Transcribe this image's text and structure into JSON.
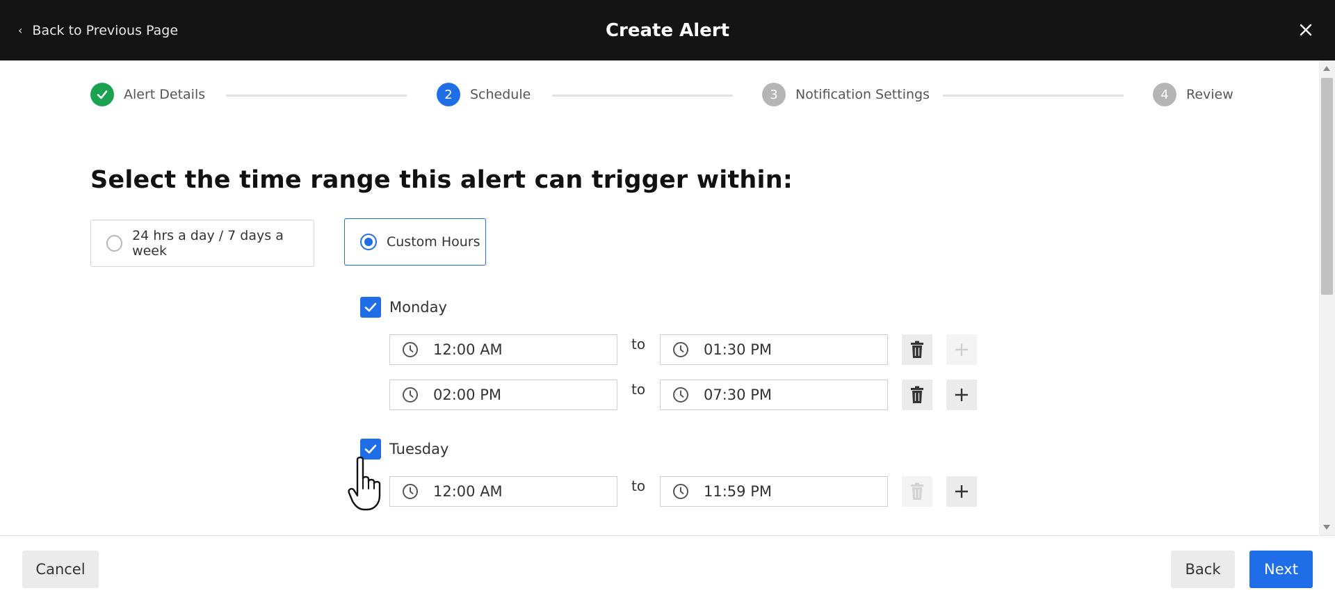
{
  "header": {
    "back_label": "Back to Previous Page",
    "title": "Create Alert"
  },
  "stepper": {
    "steps": [
      {
        "number": "1",
        "label": "Alert Details",
        "status": "done"
      },
      {
        "number": "2",
        "label": "Schedule",
        "status": "active"
      },
      {
        "number": "3",
        "label": "Notification Settings",
        "status": "pending"
      },
      {
        "number": "4",
        "label": "Review",
        "status": "pending"
      }
    ]
  },
  "schedule": {
    "heading": "Select the time range this alert can trigger within:",
    "options": [
      {
        "label": "24 hrs a day / 7 days a week",
        "selected": false
      },
      {
        "label": "Custom Hours",
        "selected": true
      }
    ],
    "to_label": "to",
    "days": [
      {
        "name": "Monday",
        "checked": true,
        "ranges": [
          {
            "start": "12:00 AM",
            "end": "01:30 PM",
            "delete_enabled": true,
            "add_enabled": false
          },
          {
            "start": "02:00 PM",
            "end": "07:30 PM",
            "delete_enabled": true,
            "add_enabled": true
          }
        ]
      },
      {
        "name": "Tuesday",
        "checked": true,
        "ranges": [
          {
            "start": "12:00 AM",
            "end": "11:59 PM",
            "delete_enabled": false,
            "add_enabled": true
          }
        ]
      }
    ]
  },
  "footer": {
    "cancel_label": "Cancel",
    "back_label": "Back",
    "next_label": "Next"
  },
  "colors": {
    "primary": "#1f6ee8",
    "success": "#1aa251",
    "header_bg": "#141414"
  }
}
